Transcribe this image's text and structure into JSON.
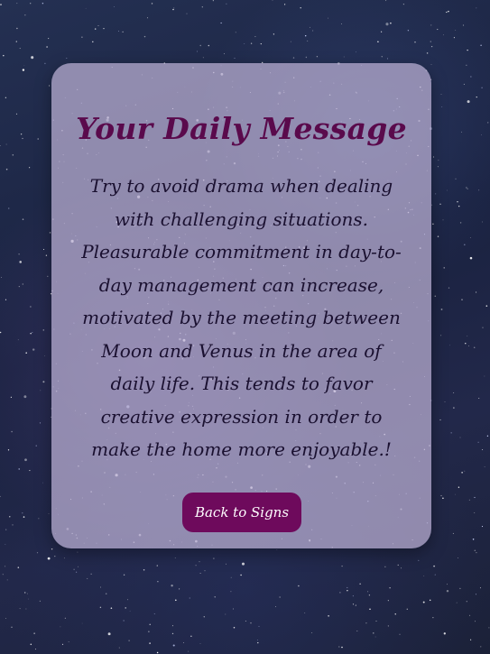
{
  "card": {
    "title": "Your Daily Message",
    "message": "Try to avoid drama when dealing with challenging situations. Pleasurable commitment in day-to-day management can increase, motivated by the meeting between Moon and Venus in the area of daily life. This tends to favor creative expression in order to make the home more enjoyable.!",
    "back_button_label": "Back to Signs"
  },
  "colors": {
    "title": "#5a0a4c",
    "button_bg": "#6e0a5c",
    "card_bg": "#bcb2d6"
  }
}
